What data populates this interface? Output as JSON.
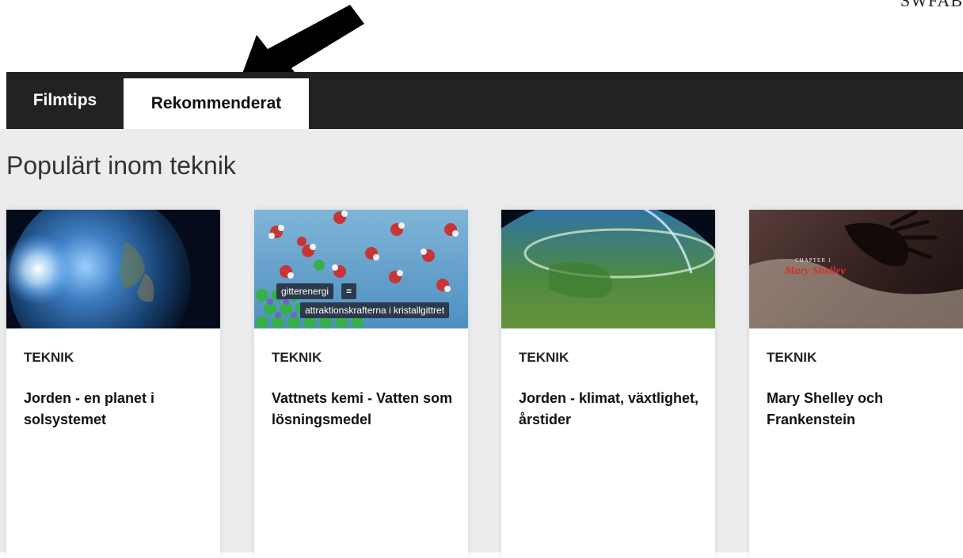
{
  "corner_label": "SWFAB",
  "nav": {
    "tabs": [
      {
        "label": "Filmtips"
      },
      {
        "label": "Rekommenderat"
      }
    ]
  },
  "section": {
    "title": "Populärt inom teknik"
  },
  "cards": [
    {
      "category": "TEKNIK",
      "title": "Jorden - en planet i solsystemet"
    },
    {
      "category": "TEKNIK",
      "title": "Vattnets kemi - Vatten som lösningsmedel",
      "overlay": {
        "label1": "gitterenergi",
        "symbol": "=",
        "label2": "attraktionskrafterna i kristallgittret"
      }
    },
    {
      "category": "TEKNIK",
      "title": "Jorden - klimat, växtlighet, årstider"
    },
    {
      "category": "TEKNIK",
      "title": "Mary Shelley och Frankenstein",
      "overlay": {
        "chapter": "CHAPTER 1",
        "name": "Mary Shelley"
      }
    }
  ]
}
